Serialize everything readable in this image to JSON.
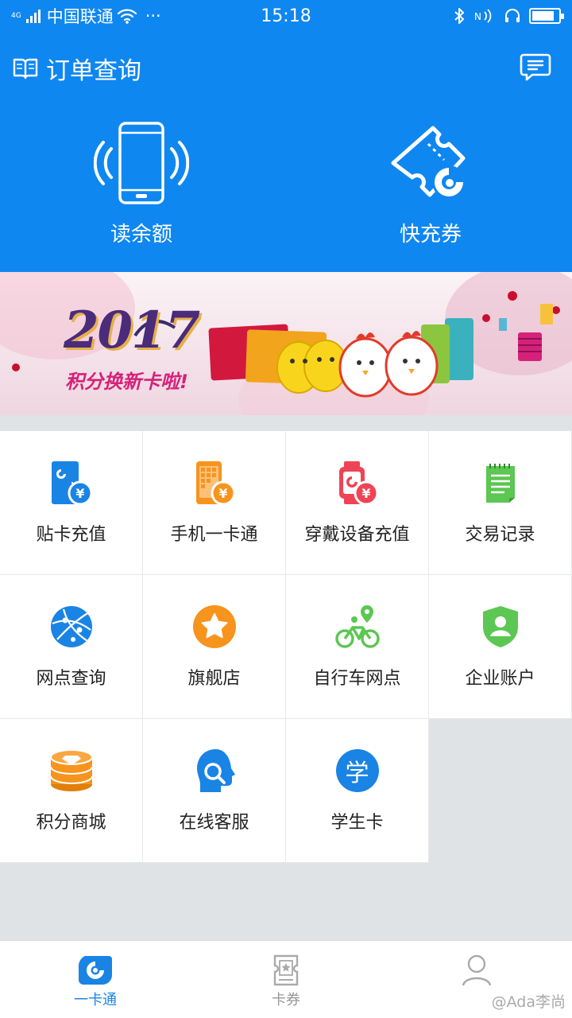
{
  "status_bar": {
    "network": "4G",
    "carrier": "中国联通",
    "more": "···",
    "time": "15:18",
    "battery_level": 0.85
  },
  "header": {
    "title": "订单查询"
  },
  "actions": [
    {
      "label": "读余额",
      "icon": "phone-nfc-icon"
    },
    {
      "label": "快充券",
      "icon": "ticket-icon"
    }
  ],
  "banner": {
    "year_text": "2017",
    "slogan": "积分换新卡啦!"
  },
  "grid": [
    {
      "label": "贴卡充值",
      "icon": "card-recharge-icon",
      "color": "#1a84e4"
    },
    {
      "label": "手机一卡通",
      "icon": "phone-card-icon",
      "color": "#f7941d"
    },
    {
      "label": "穿戴设备充值",
      "icon": "watch-recharge-icon",
      "color": "#ee4455"
    },
    {
      "label": "交易记录",
      "icon": "record-icon",
      "color": "#5cc752"
    },
    {
      "label": "网点查询",
      "icon": "globe-icon",
      "color": "#1a84e4"
    },
    {
      "label": "旗舰店",
      "icon": "star-icon",
      "color": "#f7941d"
    },
    {
      "label": "自行车网点",
      "icon": "bicycle-icon",
      "color": "#5cc752"
    },
    {
      "label": "企业账户",
      "icon": "shield-user-icon",
      "color": "#5cc752"
    },
    {
      "label": "积分商城",
      "icon": "coins-icon",
      "color": "#f7941d"
    },
    {
      "label": "在线客服",
      "icon": "service-icon",
      "color": "#1a84e4"
    },
    {
      "label": "学生卡",
      "icon": "student-icon",
      "color": "#1a84e4",
      "glyph": "学"
    }
  ],
  "bottom_nav": [
    {
      "label": "一卡通",
      "icon": "card-logo-icon",
      "active": true
    },
    {
      "label": "卡券",
      "icon": "coupon-icon",
      "active": false
    },
    {
      "label": "",
      "icon": "user-icon",
      "active": false
    }
  ],
  "watermark": "@Ada李尚"
}
